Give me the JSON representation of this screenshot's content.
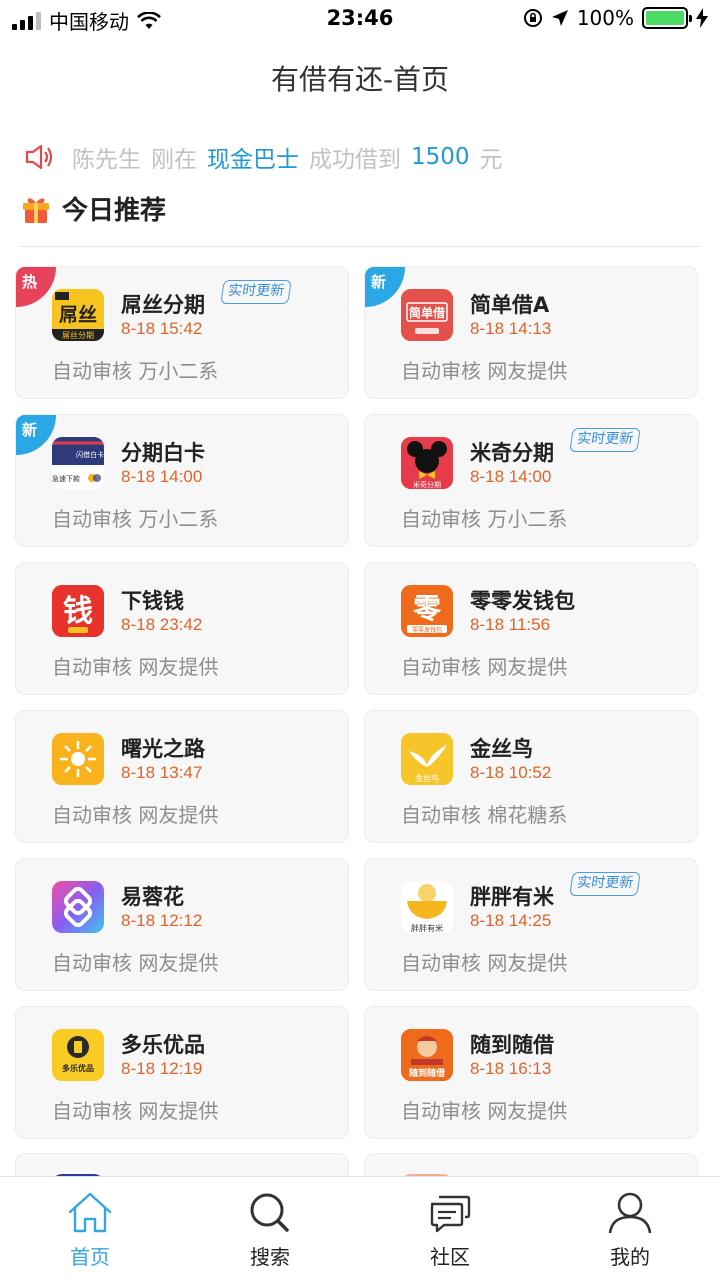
{
  "status_bar": {
    "carrier": "中国移动",
    "time": "23:46",
    "battery_percent": "100%",
    "battery_level": 1.0
  },
  "nav": {
    "title": "有借有还-首页"
  },
  "notice": {
    "user": "陈先生",
    "action": "刚在",
    "product": "现金巴士",
    "result": "成功借到",
    "amount": "1500",
    "unit": "元"
  },
  "section": {
    "title": "今日推荐"
  },
  "badges": {
    "update": "实时更新",
    "hot": "热",
    "new": "新"
  },
  "cards": [
    {
      "name": "屌丝分期",
      "time": "8-18 15:42",
      "desc": "自动审核 万小二系",
      "corner": "热",
      "update": true,
      "icon": "diaosi-icon",
      "color": "#f7c41f"
    },
    {
      "name": "简单借A",
      "time": "8-18 14:13",
      "desc": "自动审核 网友提供",
      "corner": "新",
      "update": false,
      "icon": "jiandanjie-icon",
      "color": "#e4514d"
    },
    {
      "name": "分期白卡",
      "time": "8-18 14:00",
      "desc": "自动审核 万小二系",
      "corner": "新",
      "update": false,
      "icon": "baika-icon",
      "color": "#2d3a7c"
    },
    {
      "name": "米奇分期",
      "time": "8-18 14:00",
      "desc": "自动审核 万小二系",
      "corner": "",
      "update": true,
      "icon": "miqi-icon",
      "color": "#e53b4a"
    },
    {
      "name": "下钱钱",
      "time": "8-18 23:42",
      "desc": "自动审核 网友提供",
      "corner": "",
      "update": false,
      "icon": "xiaqianqian-icon",
      "color": "#e8332d"
    },
    {
      "name": "零零发钱包",
      "time": "8-18 11:56",
      "desc": "自动审核 网友提供",
      "corner": "",
      "update": false,
      "icon": "linglingfa-icon",
      "color": "#f06a1c"
    },
    {
      "name": "曙光之路",
      "time": "8-18 13:47",
      "desc": "自动审核 网友提供",
      "corner": "",
      "update": false,
      "icon": "shuguang-icon",
      "color": "#f9b21c"
    },
    {
      "name": "金丝鸟",
      "time": "8-18 10:52",
      "desc": "自动审核 棉花糖系",
      "corner": "",
      "update": false,
      "icon": "jinsiniao-icon",
      "color": "#f6c52a"
    },
    {
      "name": "易蓉花",
      "time": "8-18 12:12",
      "desc": "自动审核 网友提供",
      "corner": "",
      "update": false,
      "icon": "yironghua-icon",
      "color": "#b04de0"
    },
    {
      "name": "胖胖有米",
      "time": "8-18 14:25",
      "desc": "自动审核 网友提供",
      "corner": "",
      "update": true,
      "icon": "pangpang-icon",
      "color": "#f4b51d"
    },
    {
      "name": "多乐优品",
      "time": "8-18 12:19",
      "desc": "自动审核 网友提供",
      "corner": "",
      "update": false,
      "icon": "duole-icon",
      "color": "#f8cc25"
    },
    {
      "name": "随到随借",
      "time": "8-18 16:13",
      "desc": "自动审核 网友提供",
      "corner": "",
      "update": false,
      "icon": "suidao-icon",
      "color": "#f06a1c"
    }
  ],
  "icon_text": {
    "diaosi": "屌丝",
    "diaosi_sub": "屌丝分期",
    "jiandanjie": "简单借",
    "baika_top": "闪借白卡",
    "baika_bottom": "急速下款",
    "miqi": "米奇分期",
    "xiaqianqian": "钱",
    "lingling": "零",
    "lingling_sub": "零零发钱包",
    "jinsiniao": "金丝鸟",
    "pangpang": "胖胖有米",
    "duole": "多乐优品",
    "suidao": "随到随借"
  },
  "tabs": [
    {
      "label": "首页",
      "icon": "home-icon",
      "active": true
    },
    {
      "label": "搜索",
      "icon": "search-icon",
      "active": false
    },
    {
      "label": "社区",
      "icon": "chat-icon",
      "active": false
    },
    {
      "label": "我的",
      "icon": "user-icon",
      "active": false
    }
  ],
  "colors": {
    "accent": "#34a7e3",
    "notice_highlight": "#1e9bd7",
    "time_orange": "#e0642a",
    "hot_corner": "#e8425a",
    "new_corner": "#2aa7e4"
  }
}
